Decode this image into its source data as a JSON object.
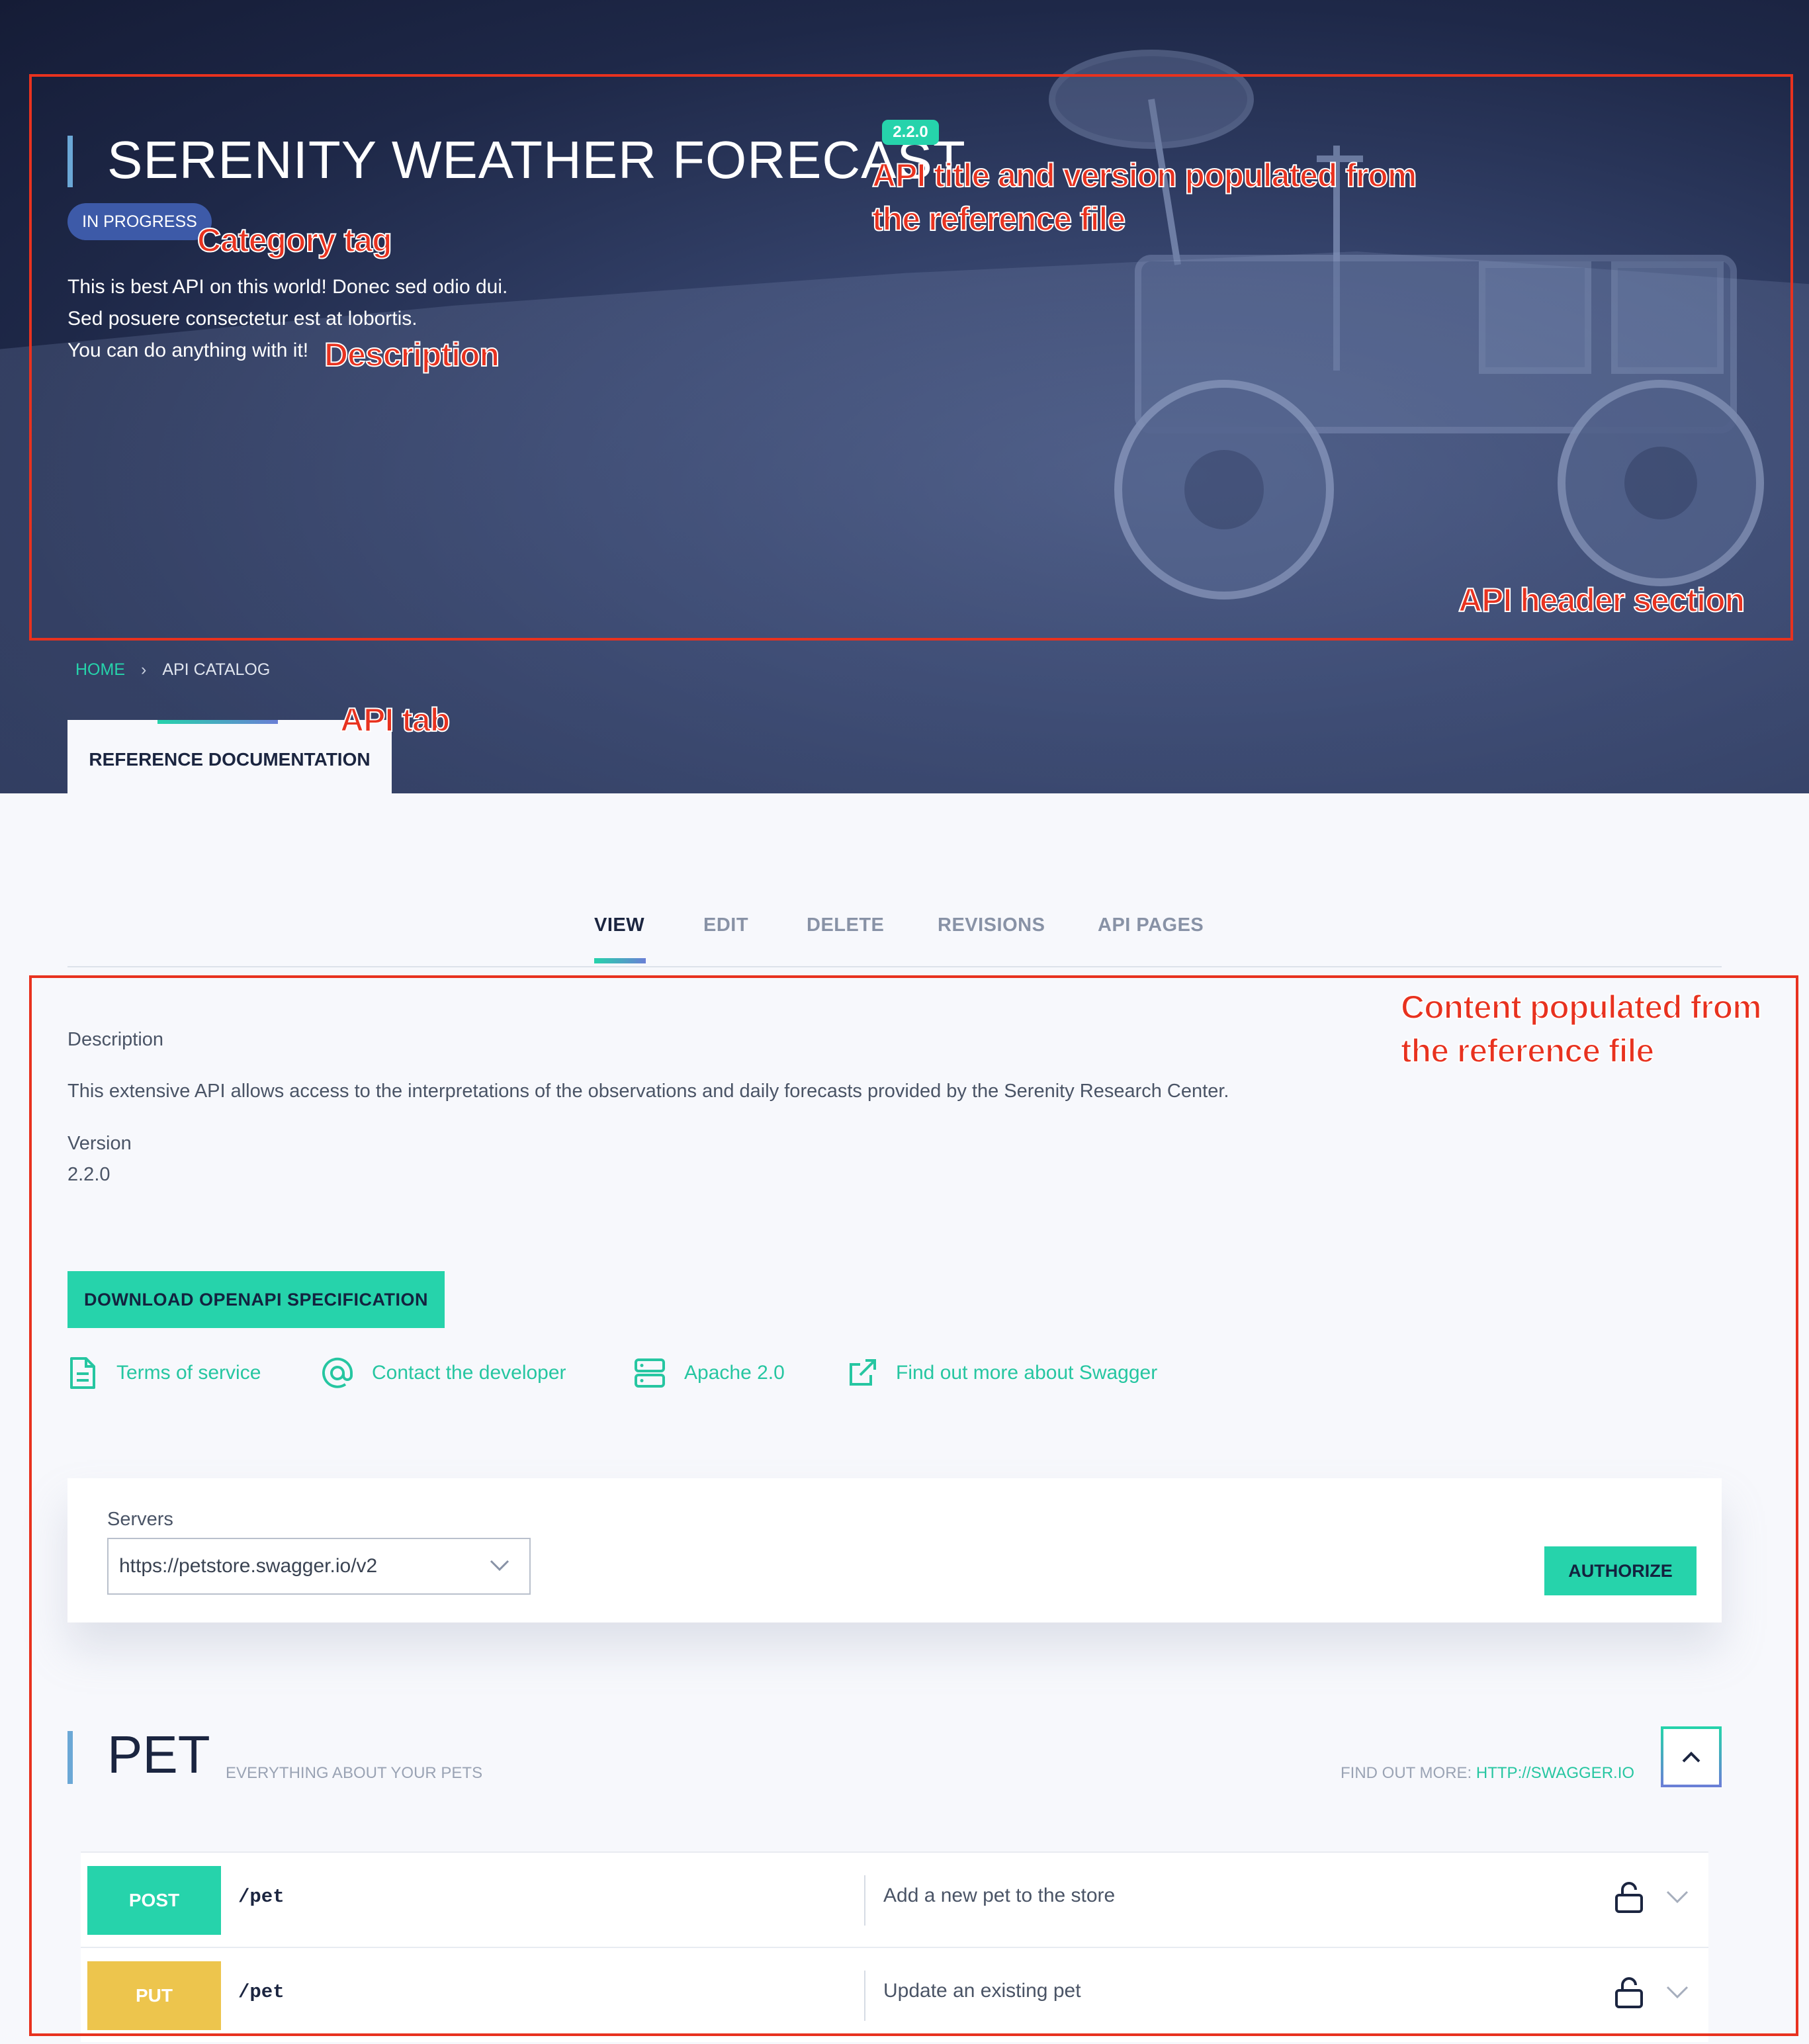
{
  "header": {
    "title": "SERENITY WEATHER FORECAST",
    "version": "2.2.0",
    "category_tag": "IN PROGRESS",
    "description_lines": [
      "This is best API on this world! Donec sed odio dui.",
      "Sed posuere consectetur est at lobortis.",
      "You can do anything with it!"
    ]
  },
  "breadcrumb": {
    "home": "HOME",
    "separator": "›",
    "current": "API CATALOG"
  },
  "api_tab": {
    "label": "REFERENCE DOCUMENTATION"
  },
  "tabs": [
    {
      "label": "VIEW",
      "active": true
    },
    {
      "label": "EDIT",
      "active": false
    },
    {
      "label": "DELETE",
      "active": false
    },
    {
      "label": "REVISIONS",
      "active": false
    },
    {
      "label": "API PAGES",
      "active": false
    }
  ],
  "info": {
    "description_label": "Description",
    "description_text": "This extensive API allows access to the interpretations of the observations and daily forecasts provided by the Serenity Research Center.",
    "version_label": "Version",
    "version_value": "2.2.0"
  },
  "download_button": "DOWNLOAD OPENAPI SPECIFICATION",
  "links": [
    {
      "label": "Terms of service",
      "icon": "document-icon"
    },
    {
      "label": "Contact the developer",
      "icon": "at-sign-icon"
    },
    {
      "label": "Apache 2.0",
      "icon": "server-icon"
    },
    {
      "label": "Find out more about Swagger",
      "icon": "external-link-icon"
    }
  ],
  "servers": {
    "label": "Servers",
    "selected": "https://petstore.swagger.io/v2",
    "authorize_label": "AUTHORIZE"
  },
  "pet_section": {
    "title": "PET",
    "subtitle": "EVERYTHING ABOUT YOUR PETS",
    "find_more_label": "FIND OUT MORE:",
    "find_more_url": "HTTP://SWAGGER.IO"
  },
  "operations": [
    {
      "method": "POST",
      "path": "/pet",
      "summary": "Add a new pet to the store",
      "color": "#26d3ab"
    },
    {
      "method": "PUT",
      "path": "/pet",
      "summary": "Update an existing pet",
      "color": "#edc54d"
    }
  ],
  "annotations": {
    "title_version": [
      "API title and version populated from",
      "the reference file"
    ],
    "category": "Category tag",
    "description": "Description",
    "header_section": "API header section",
    "api_tab": "API tab",
    "content": [
      "Content populated from",
      "the reference file"
    ]
  },
  "colors": {
    "accent": "#26d3ab",
    "annotation": "#e8321f",
    "hero_bg": "#1e2848"
  }
}
